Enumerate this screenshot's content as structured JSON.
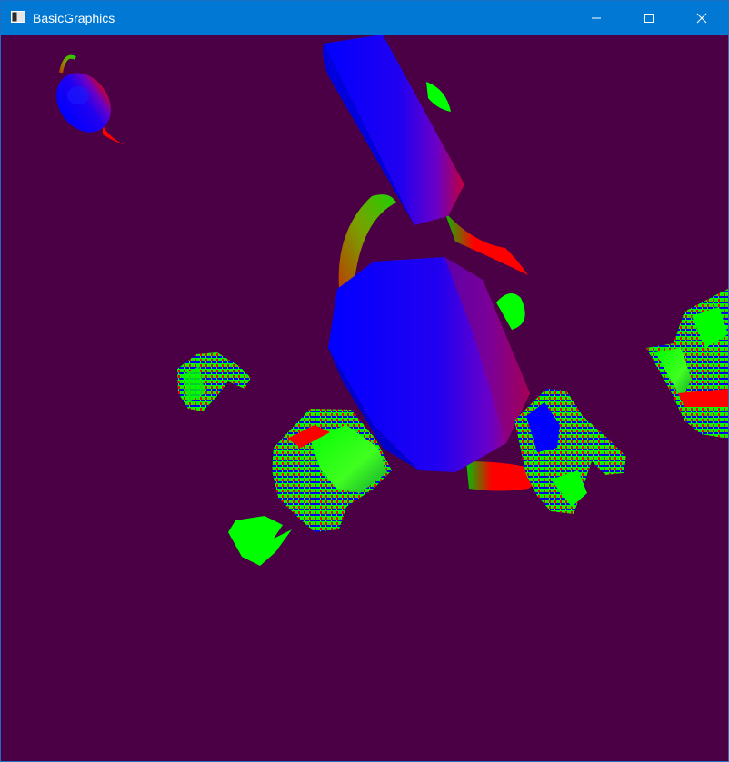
{
  "window": {
    "title": "BasicGraphics",
    "background_color": "#4b0045",
    "titlebar_color": "#0078d4"
  },
  "titlebar": {
    "app_icon": "window-icon",
    "controls": [
      {
        "name": "minimize",
        "icon": "minimize-icon"
      },
      {
        "name": "maximize",
        "icon": "maximize-icon"
      },
      {
        "name": "close",
        "icon": "close-icon"
      }
    ]
  },
  "scene": {
    "description_colors": [
      "#0000ff",
      "#00ff00",
      "#ff0000"
    ],
    "objects": [
      {
        "name": "teapot-small-top-left",
        "type": "teapot"
      },
      {
        "name": "teapot-large-top",
        "type": "teapot"
      },
      {
        "name": "teapot-center",
        "type": "teapot"
      },
      {
        "name": "bunny-small-left",
        "type": "bunny"
      },
      {
        "name": "bunny-lower-left",
        "type": "bunny"
      },
      {
        "name": "bunny-center-right",
        "type": "bunny"
      },
      {
        "name": "bunny-right-edge",
        "type": "bunny"
      }
    ]
  }
}
